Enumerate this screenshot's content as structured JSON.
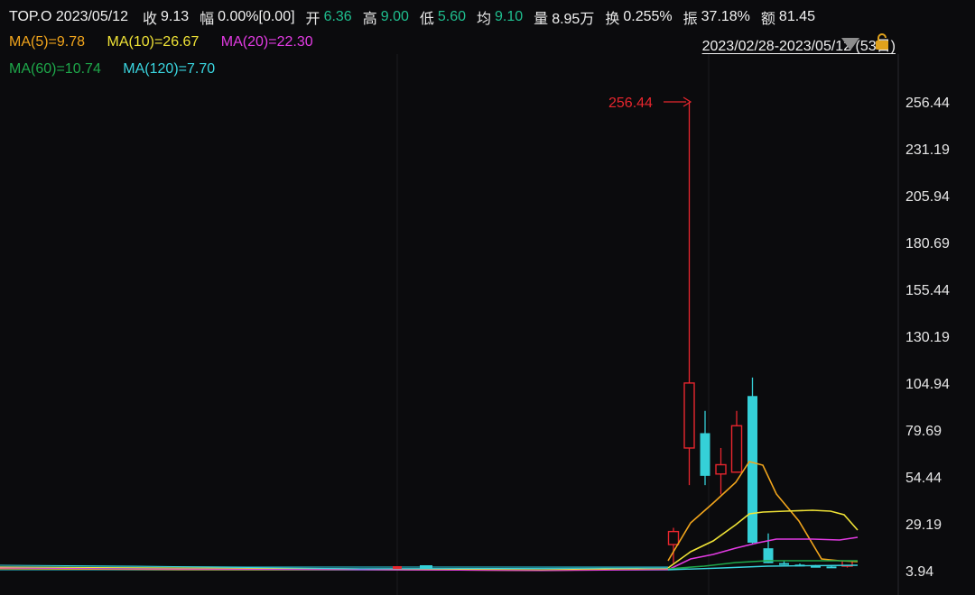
{
  "header": {
    "symbol": "TOP.O",
    "date": "2023/05/12",
    "fields": [
      {
        "label": "收",
        "value": "9.13",
        "color": "#f2f2f2"
      },
      {
        "label": "幅",
        "value": "0.00%[0.00]",
        "color": "#f2f2f2"
      },
      {
        "label": "开",
        "value": "6.36",
        "color": "#1fbf8f"
      },
      {
        "label": "高",
        "value": "9.00",
        "color": "#1fbf8f"
      },
      {
        "label": "低",
        "value": "5.60",
        "color": "#1fbf8f"
      },
      {
        "label": "均",
        "value": "9.10",
        "color": "#1fbf8f"
      },
      {
        "label": "量",
        "value": "8.95万",
        "color": "#f2f2f2"
      },
      {
        "label": "换",
        "value": "0.255%",
        "color": "#f2f2f2"
      },
      {
        "label": "振",
        "value": "37.18%",
        "color": "#f2f2f2"
      },
      {
        "label": "额",
        "value": "81.45",
        "color": "#f2f2f2"
      }
    ]
  },
  "ma": {
    "ma5": "MA(5)=9.78",
    "ma10": "MA(10)=26.67",
    "ma20": "MA(20)=22.30",
    "ma60": "MA(60)=10.74",
    "ma120": "MA(120)=7.70"
  },
  "range_label": "2023/02/28-2023/05/12 (53日)",
  "peak_label": "256.44",
  "colors": {
    "up": "#e8262e",
    "down": "#35d0d8",
    "ma5": "#f2a51c",
    "ma10": "#efe236",
    "ma20": "#e33be3",
    "ma60": "#1ea84a",
    "ma120": "#3ad6e0"
  },
  "chart_data": {
    "type": "candlestick",
    "y_ticks": [
      "256.44",
      "231.19",
      "205.94",
      "180.69",
      "155.44",
      "130.19",
      "104.94",
      "79.69",
      "54.44",
      "29.19",
      "3.94"
    ],
    "ylim": [
      3.94,
      256.44
    ],
    "candles": [
      {
        "o": 18,
        "c": 25,
        "h": 27,
        "l": 8
      },
      {
        "o": 70,
        "c": 105,
        "h": 256.44,
        "l": 50
      },
      {
        "o": 78,
        "c": 55,
        "h": 90,
        "l": 50
      },
      {
        "o": 56,
        "c": 61,
        "h": 70,
        "l": 45
      },
      {
        "o": 57,
        "c": 82,
        "h": 90,
        "l": 57
      },
      {
        "o": 98,
        "c": 19,
        "h": 108,
        "l": 18
      },
      {
        "o": 16,
        "c": 8,
        "h": 24,
        "l": 8
      },
      {
        "o": 8,
        "c": 7.5,
        "h": 9,
        "l": 7
      },
      {
        "o": 7.2,
        "c": 6.8,
        "h": 7.8,
        "l": 6.3
      },
      {
        "o": 6.5,
        "c": 6.2,
        "h": 7,
        "l": 6
      },
      {
        "o": 6.2,
        "c": 6.0,
        "h": 6.6,
        "l": 5.8
      },
      {
        "o": 6.36,
        "c": 9.13,
        "h": 9.0,
        "l": 5.6
      }
    ]
  }
}
